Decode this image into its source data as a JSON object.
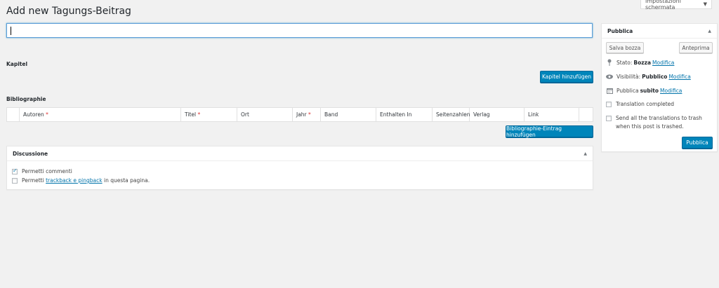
{
  "screen_options": {
    "label": "Impostazioni schermata"
  },
  "page_title": "Add new Tagungs-Beitrag",
  "title_input": {
    "value": "",
    "placeholder": ""
  },
  "kapitel": {
    "label": "Kapitel",
    "add_button": "Kapitel hinzufügen"
  },
  "bibliographie": {
    "label": "Bibliographie",
    "columns": [
      {
        "label": "",
        "required": false
      },
      {
        "label": "Autoren",
        "required": true
      },
      {
        "label": "Titel",
        "required": true
      },
      {
        "label": "Ort",
        "required": false
      },
      {
        "label": "Jahr",
        "required": true
      },
      {
        "label": "Band",
        "required": false
      },
      {
        "label": "Enthalten In",
        "required": false
      },
      {
        "label": "Seitenzahlen",
        "required": false
      },
      {
        "label": "Verlag",
        "required": false
      },
      {
        "label": "Link",
        "required": false
      },
      {
        "label": "",
        "required": false
      }
    ],
    "add_button": "Bibliographie-Eintrag hinzufügen"
  },
  "discussione": {
    "title": "Discussione",
    "allow_comments": {
      "label": "Permetti commenti",
      "checked": true
    },
    "trackback": {
      "prefix": "Permetti",
      "link": "trackback e pingback",
      "suffix": "in questa pagina.",
      "checked": false
    }
  },
  "pubblica": {
    "title": "Pubblica",
    "save_draft": "Salva bozza",
    "preview": "Anteprima",
    "status": {
      "label": "Stato:",
      "value": "Bozza",
      "edit": "Modifica"
    },
    "visibility": {
      "label": "Visibilità:",
      "value": "Pubblico",
      "edit": "Modifica"
    },
    "publish_time": {
      "label": "Pubblica",
      "value": "subito",
      "edit": "Modifica"
    },
    "translation_completed": {
      "label": "Translation completed",
      "checked": false
    },
    "send_translations": {
      "label": "Send all the translations to trash when this post is trashed.",
      "checked": false
    },
    "publish_button": "Pubblica"
  },
  "colors": {
    "primary": "#0085ba",
    "link": "#0073aa",
    "required": "#dc3232",
    "background": "#f1f1f1"
  }
}
